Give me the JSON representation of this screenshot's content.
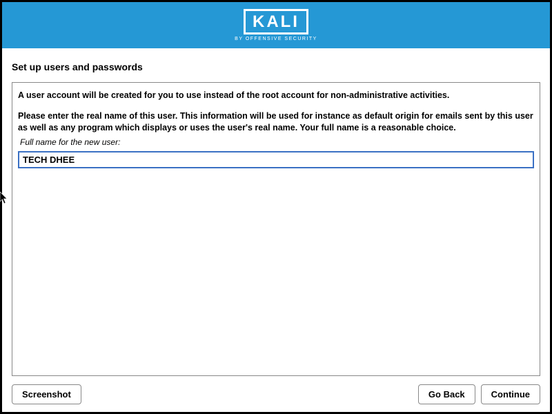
{
  "header": {
    "logo_text": "KALI",
    "logo_subtitle": "BY OFFENSIVE SECURITY"
  },
  "page": {
    "title": "Set up users and passwords"
  },
  "content": {
    "intro_line1": "A user account will be created for you to use instead of the root account for non-administrative activities.",
    "intro_para2": "Please enter the real name of this user. This information will be used for instance as default origin for emails sent by this user as well as any program which displays or uses the user's real name. Your full name is a reasonable choice.",
    "field_label": "Full name for the new user:",
    "fullname_value": "TECH DHEE"
  },
  "buttons": {
    "screenshot": "Screenshot",
    "go_back": "Go Back",
    "continue": "Continue"
  }
}
